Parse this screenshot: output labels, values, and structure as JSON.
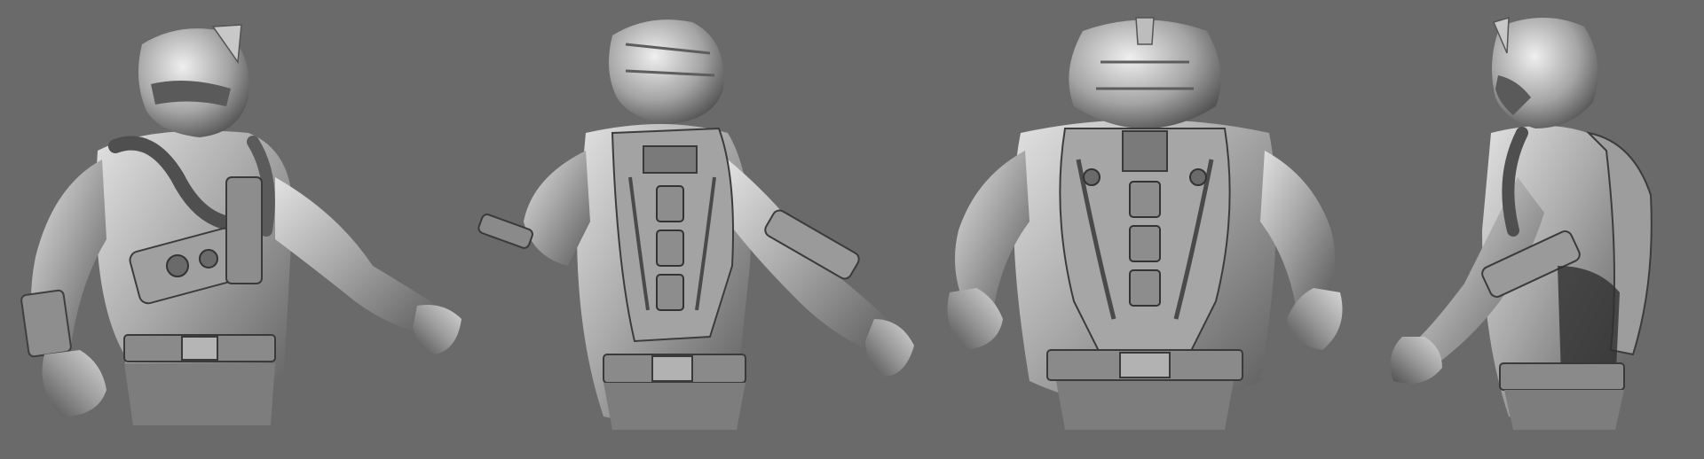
{
  "scene": {
    "background_color": "#6a6a6a",
    "material_light": "#d6d6d6",
    "material_mid": "#9d9d9d",
    "material_dark": "#4a4a4a",
    "description_views": [
      "front-three-quarter",
      "back-three-quarter",
      "back",
      "side-profile"
    ]
  }
}
